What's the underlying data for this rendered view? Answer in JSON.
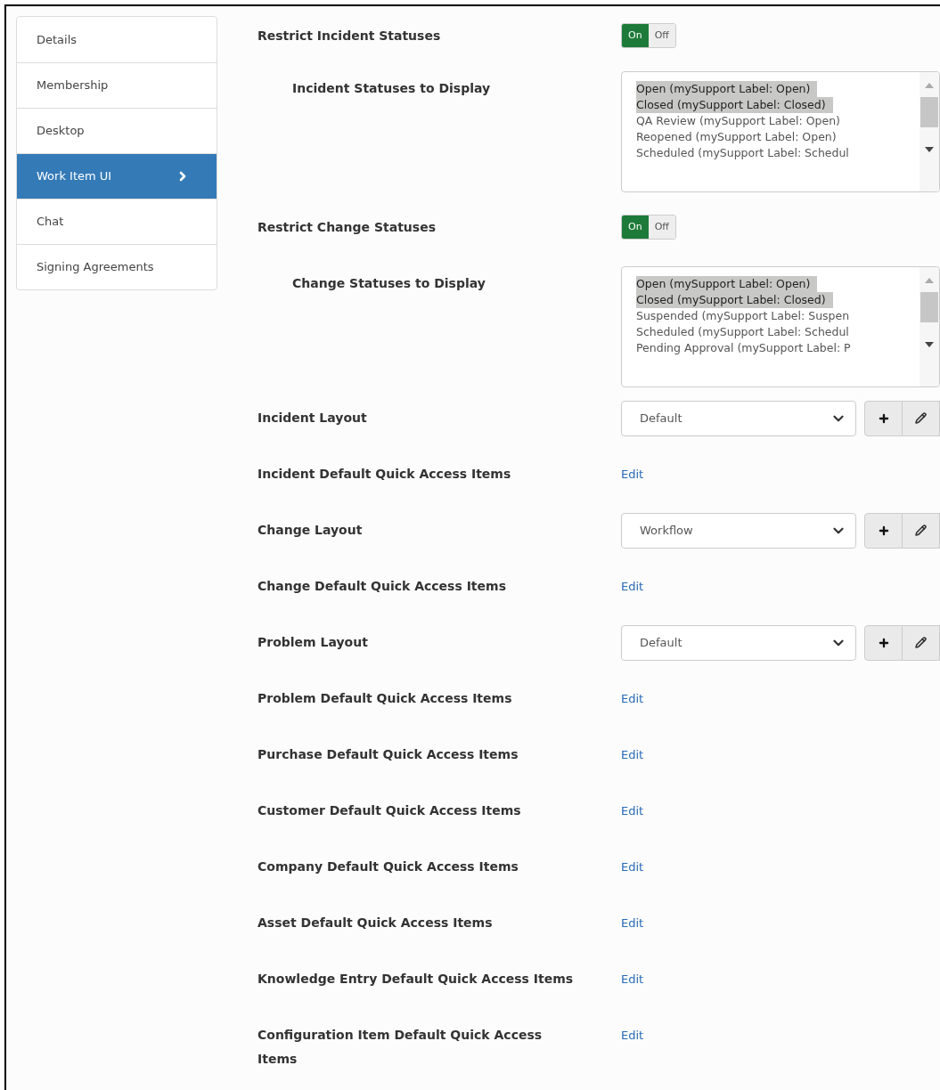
{
  "sidebar": {
    "items": [
      {
        "label": "Details",
        "selected": false
      },
      {
        "label": "Membership",
        "selected": false
      },
      {
        "label": "Desktop",
        "selected": false
      },
      {
        "label": "Work Item UI",
        "selected": true
      },
      {
        "label": "Chat",
        "selected": false
      },
      {
        "label": "Signing Agreements",
        "selected": false
      }
    ]
  },
  "settings": [
    {
      "kind": "toggle",
      "label": "Restrict Incident Statuses",
      "on_label": "On",
      "off_label": "Off",
      "on": true
    },
    {
      "kind": "listbox",
      "label": "Incident Statuses to Display",
      "options": [
        {
          "label": "Open (mySupport Label: Open)",
          "selected": true
        },
        {
          "label": "Closed (mySupport Label: Closed)",
          "selected": true
        },
        {
          "label": "QA Review (mySupport Label: Open)",
          "selected": false
        },
        {
          "label": "Reopened (mySupport Label: Open)",
          "selected": false
        },
        {
          "label": "Scheduled (mySupport Label: Schedul",
          "selected": false
        }
      ]
    },
    {
      "kind": "toggle",
      "label": "Restrict Change Statuses",
      "on_label": "On",
      "off_label": "Off",
      "on": true
    },
    {
      "kind": "listbox",
      "label": "Change Statuses to Display",
      "options": [
        {
          "label": "Open (mySupport Label: Open)",
          "selected": true
        },
        {
          "label": "Closed (mySupport Label: Closed)",
          "selected": true
        },
        {
          "label": "Suspended (mySupport Label: Suspen",
          "selected": false
        },
        {
          "label": "Scheduled (mySupport Label: Schedul",
          "selected": false
        },
        {
          "label": "Pending Approval (mySupport Label: P",
          "selected": false
        }
      ]
    },
    {
      "kind": "dropdown",
      "label": "Incident Layout",
      "value": "Default"
    },
    {
      "kind": "link",
      "label": "Incident Default Quick Access Items",
      "link": "Edit"
    },
    {
      "kind": "dropdown",
      "label": "Change Layout",
      "value": "Workflow"
    },
    {
      "kind": "link",
      "label": "Change Default Quick Access Items",
      "link": "Edit"
    },
    {
      "kind": "dropdown",
      "label": "Problem Layout",
      "value": "Default"
    },
    {
      "kind": "link",
      "label": "Problem Default Quick Access Items",
      "link": "Edit"
    },
    {
      "kind": "link",
      "label": "Purchase Default Quick Access Items",
      "link": "Edit"
    },
    {
      "kind": "link",
      "label": "Customer Default Quick Access Items",
      "link": "Edit"
    },
    {
      "kind": "link",
      "label": "Company Default Quick Access Items",
      "link": "Edit"
    },
    {
      "kind": "link",
      "label": "Asset Default Quick Access Items",
      "link": "Edit"
    },
    {
      "kind": "link",
      "label": "Knowledge Entry Default Quick Access Items",
      "link": "Edit"
    },
    {
      "kind": "link",
      "label": "Configuration Item Default Quick Access Items",
      "link": "Edit"
    }
  ]
}
